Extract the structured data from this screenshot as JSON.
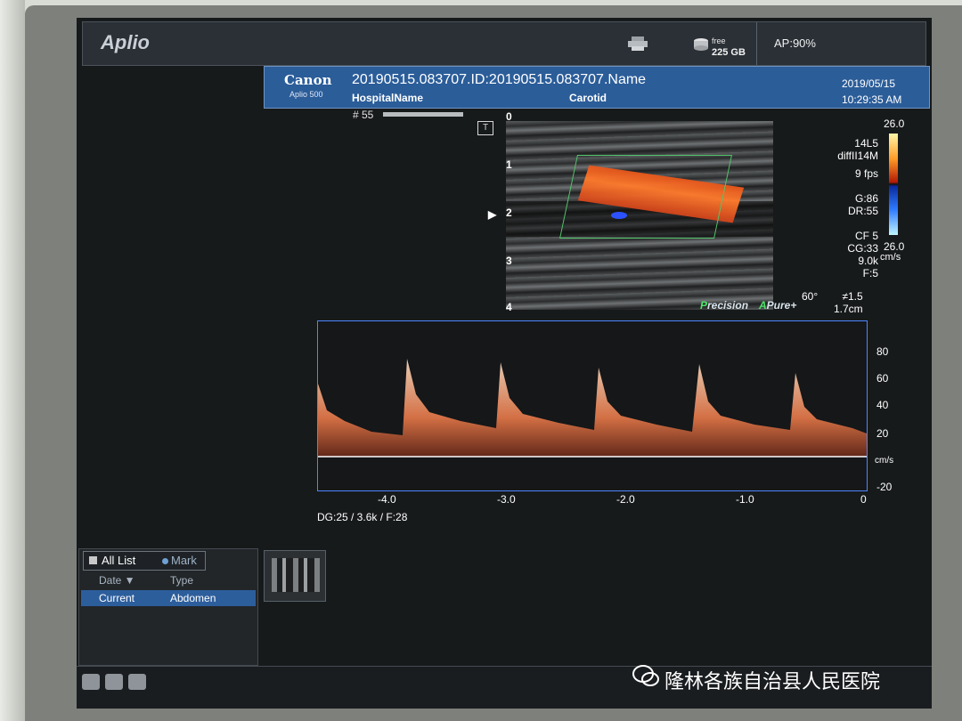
{
  "app": {
    "name": "Aplio",
    "printer_icon": "printer-icon",
    "disk_icon": "disk-icon",
    "disk_free_label": "free",
    "disk_free_value": "225 GB",
    "ap": "AP:90%"
  },
  "study": {
    "brand": "Canon",
    "model": "Aplio 500",
    "id_line": "20190515.083707.ID:20190515.083707.Name",
    "hospital": "HospitalName",
    "exam": "Carotid",
    "date": "2019/05/15",
    "time": "10:29:35 AM"
  },
  "image": {
    "frame": "# 55",
    "depth_marks": [
      "0",
      "1",
      "2",
      "3",
      "4"
    ],
    "params": [
      "14L5",
      "diffII14M",
      "9 fps",
      "",
      "G:86",
      "DR:55",
      "",
      "CF 5",
      "CG:33",
      "9.0k",
      "F:5"
    ],
    "angle": "60°",
    "extra": [
      "≠1.5",
      "1.7cm"
    ],
    "color_bar": {
      "top": "26.0",
      "bottom": "26.0",
      "unit": "cm/s"
    },
    "precision_prefix": "P",
    "precision_rest": "recision",
    "apure_prefix": "A",
    "apure_rest": "Pure+"
  },
  "doppler": {
    "y_ticks": [
      "80",
      "60",
      "40",
      "20",
      "cm/s",
      "-20"
    ],
    "x_ticks": [
      "-4.0",
      "-3.0",
      "-2.0",
      "-1.0",
      "0"
    ],
    "dg_line": "DG:25  / 3.6k   / F:28"
  },
  "list_panel": {
    "tab_all": "All List",
    "tab_mark": "Mark",
    "col_date": "Date ▼",
    "col_type": "Type",
    "row_current": "Current",
    "row_type": "Abdomen"
  },
  "watermark": "隆林各族自治县人民医院",
  "colors": {
    "screen": "#171a1b",
    "infobar": "#2b5d99",
    "doppler_border": "#4d86ff",
    "flow": "#e8561a"
  }
}
